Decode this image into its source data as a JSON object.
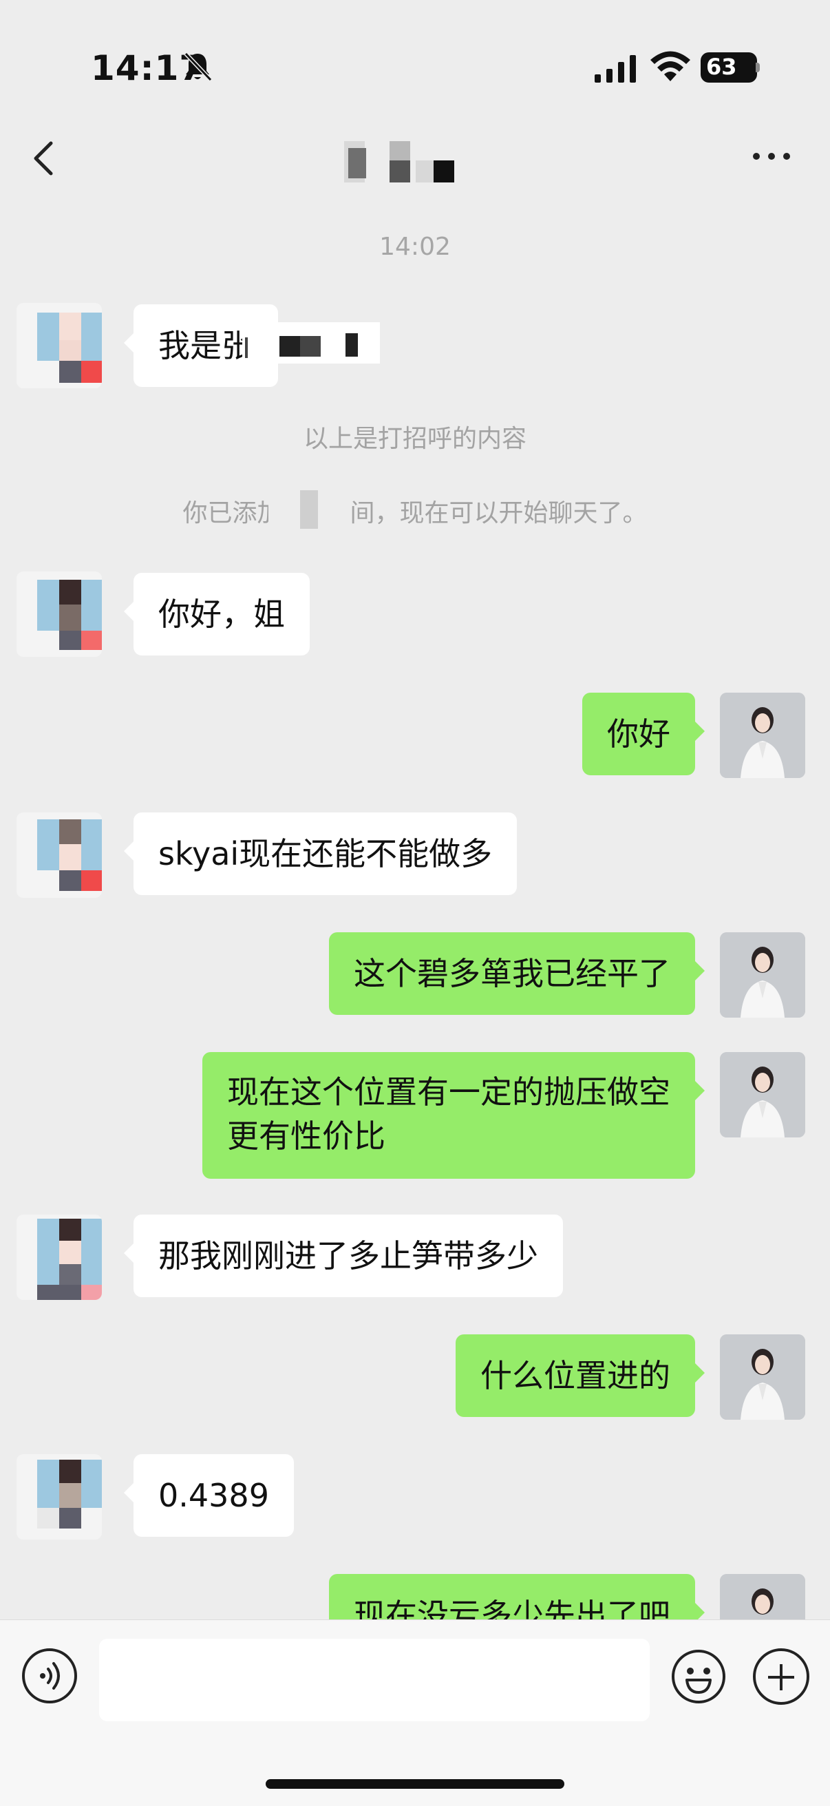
{
  "status_bar": {
    "time": "14:17",
    "battery": "63"
  },
  "header": {
    "title": ""
  },
  "chat": {
    "timestamp": "14:02",
    "system_greeting": "以上是打招呼的内容",
    "system_added": "你已添加了       间，现在可以开始聊天了。",
    "messages": [
      {
        "side": "left",
        "text": "我是张"
      },
      {
        "side": "left",
        "text": "你好，姐"
      },
      {
        "side": "right",
        "text": "你好"
      },
      {
        "side": "left",
        "text": "skyai现在还能不能做多"
      },
      {
        "side": "right",
        "text": "这个碧多箪我已经平了"
      },
      {
        "side": "right",
        "lines": [
          "现在这个位置有一定的抛压做空",
          "更有性价比"
        ]
      },
      {
        "side": "left",
        "text": "那我刚刚进了多止笋带多少"
      },
      {
        "side": "right",
        "text": "什么位置进的"
      },
      {
        "side": "left",
        "text": "0.4389"
      },
      {
        "side": "right",
        "text": "现在没亏多少先出了吧"
      }
    ]
  },
  "input_bar": {
    "placeholder": ""
  },
  "colors": {
    "background": "#ededed",
    "sent_bubble": "#95ec69",
    "received_bubble": "#ffffff"
  }
}
